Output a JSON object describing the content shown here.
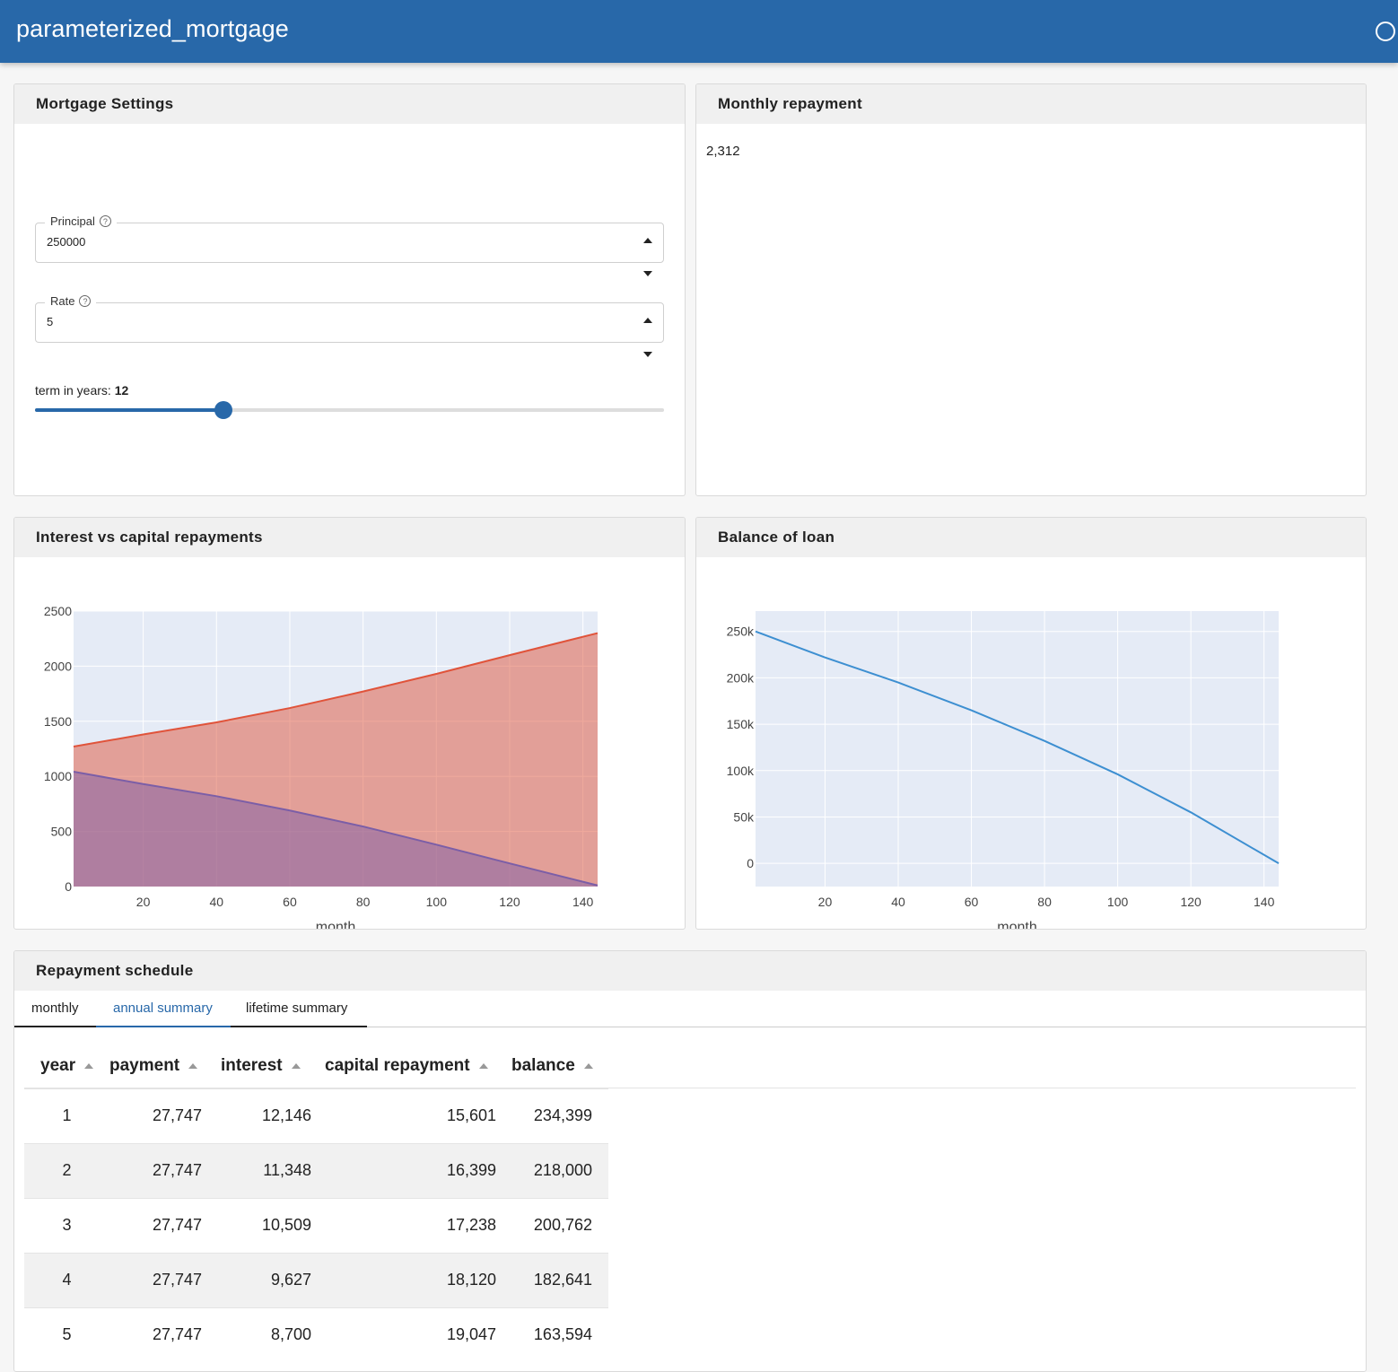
{
  "app": {
    "title": "parameterized_mortgage"
  },
  "settings": {
    "header": "Mortgage Settings",
    "principal": {
      "label": "Principal",
      "value": "250000"
    },
    "rate": {
      "label": "Rate",
      "value": "5"
    },
    "term": {
      "label": "term in years: ",
      "value": "12",
      "min": 1,
      "max": 35,
      "fraction": 0.3
    }
  },
  "monthly": {
    "header": "Monthly repayment",
    "value": "2,312"
  },
  "interest_chart": {
    "header": "Interest vs capital repayments"
  },
  "balance_chart": {
    "header": "Balance of loan"
  },
  "chart_data": [
    {
      "type": "area",
      "title": "Interest vs capital repayments",
      "xlabel": "month",
      "ylabel": "",
      "xlim": [
        1,
        144
      ],
      "ylim": [
        0,
        2500
      ],
      "x_ticks": [
        "20",
        "40",
        "60",
        "80",
        "100",
        "120",
        "140"
      ],
      "y_ticks": [
        "0",
        "500",
        "1000",
        "1500",
        "2000",
        "2500"
      ],
      "x": [
        1,
        20,
        40,
        60,
        80,
        100,
        120,
        144
      ],
      "series": [
        {
          "values": [
            1270,
            1380,
            1490,
            1620,
            1770,
            1930,
            2100,
            2300
          ],
          "color": "#e0533a"
        },
        {
          "values": [
            1042,
            930,
            820,
            690,
            545,
            380,
            210,
            10
          ],
          "color": "#7b5ea7"
        }
      ],
      "grid": true
    },
    {
      "type": "line",
      "title": "Balance of loan",
      "xlabel": "month",
      "ylabel": "",
      "xlim": [
        1,
        144
      ],
      "ylim": [
        -25000,
        272000
      ],
      "x_ticks": [
        "20",
        "40",
        "60",
        "80",
        "100",
        "120",
        "140"
      ],
      "y_ticks": [
        "0",
        "50k",
        "100k",
        "150k",
        "200k",
        "250k"
      ],
      "x": [
        1,
        20,
        40,
        60,
        80,
        100,
        120,
        144
      ],
      "series": [
        {
          "values": [
            250000,
            222000,
            195000,
            165000,
            132000,
            96000,
            55000,
            0
          ],
          "color": "#3d8fd1"
        }
      ],
      "grid": true
    }
  ],
  "schedule": {
    "header": "Repayment schedule",
    "tabs": [
      "monthly",
      "annual summary",
      "lifetime summary"
    ],
    "active_tab": "annual summary",
    "columns": [
      "year",
      "payment",
      "interest",
      "capital repayment",
      "balance"
    ],
    "rows": [
      [
        "1",
        "27,747",
        "12,146",
        "15,601",
        "234,399"
      ],
      [
        "2",
        "27,747",
        "11,348",
        "16,399",
        "218,000"
      ],
      [
        "3",
        "27,747",
        "10,509",
        "17,238",
        "200,762"
      ],
      [
        "4",
        "27,747",
        "9,627",
        "18,120",
        "182,641"
      ],
      [
        "5",
        "27,747",
        "8,700",
        "19,047",
        "163,594"
      ]
    ]
  }
}
